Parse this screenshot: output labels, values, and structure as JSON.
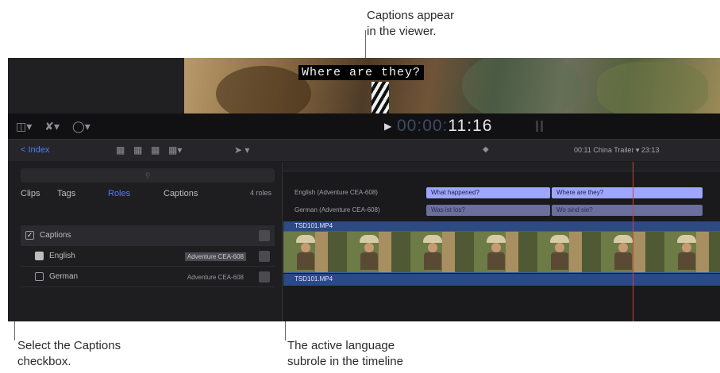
{
  "callouts": {
    "top": [
      "Captions appear",
      "in the viewer."
    ],
    "bottom_left": [
      "Select the Captions",
      "checkbox."
    ],
    "bottom_right": [
      "The active language",
      "subrole in the timeline"
    ]
  },
  "viewer": {
    "caption_text": "Where are they?"
  },
  "toolbar": {
    "icons": [
      "layout-icon",
      "trim-tool-icon",
      "speed-icon"
    ],
    "timecode_dim": "00:00:",
    "timecode_lit": "11:16"
  },
  "browser_header": {
    "index_label": "< Index",
    "project_name": "00:11 China Trailer ▾",
    "project_duration": "23:13"
  },
  "index_panel": {
    "tabs": [
      {
        "label": "Clips",
        "active": false
      },
      {
        "label": "Tags",
        "active": false
      },
      {
        "label": "Roles",
        "active": true
      },
      {
        "label": "Captions",
        "active": false
      }
    ],
    "count": "4 roles",
    "rows": [
      {
        "label": "Captions",
        "checked": true,
        "subrole": "",
        "highlight": false,
        "header": true
      },
      {
        "label": "English",
        "checked": true,
        "subrole": "Adventure CEA-608",
        "highlight": true,
        "header": false
      },
      {
        "label": "German",
        "checked": false,
        "subrole": "Adventure CEA-608",
        "highlight": false,
        "header": false
      }
    ]
  },
  "timeline": {
    "lanes": [
      {
        "label": "English (Adventure CEA-608)",
        "clips": [
          "What happened?",
          "Where are they?"
        ]
      },
      {
        "label": "German (Adventure CEA-608)",
        "clips": [
          "Was ist los?",
          "Wo sind sie?"
        ]
      }
    ],
    "storyline_label": "TSD101.MP4",
    "audio_label": "TSD101.MP4"
  },
  "colors": {
    "accent": "#4e7cff",
    "caption_en": "#9fa6ff",
    "caption_de": "#6a6f9e",
    "playhead": "#d04040"
  }
}
